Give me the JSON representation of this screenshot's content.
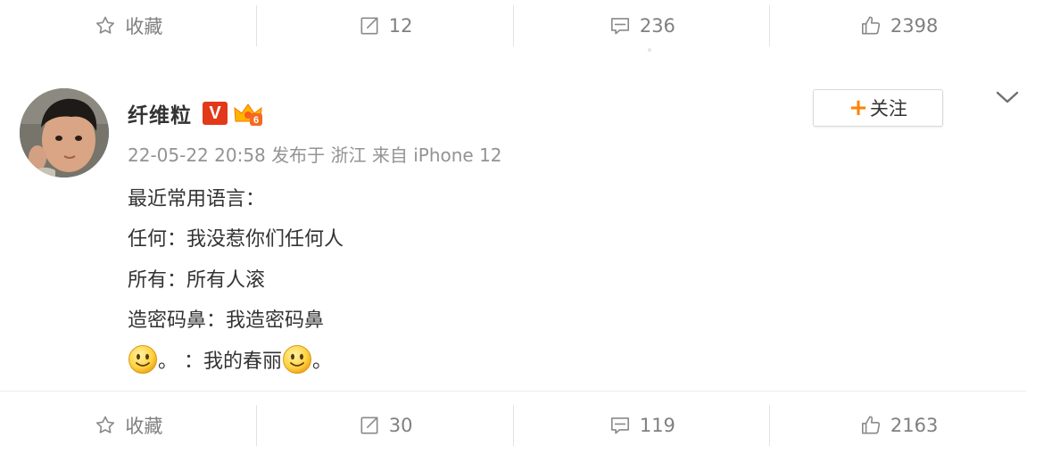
{
  "top_actions": {
    "favorite_label": "收藏",
    "repost_count": "12",
    "comment_count": "236",
    "like_count": "2398"
  },
  "post": {
    "author_name": "纤维粒",
    "vip_badge": "V",
    "level_badge_icon": "level-crown-badge",
    "meta": "22-05-22 20:58 发布于 浙江 来自 iPhone 12",
    "follow_plus": "+",
    "follow_label": "关注",
    "content_lines": [
      "最近常用语言：",
      "任何：我没惹你们任何人",
      "所有：所有人滚",
      "造密码鼻：我造密码鼻"
    ],
    "emoji_line": {
      "part1": "。 ：我的春丽",
      "part2": "。"
    }
  },
  "bottom_actions": {
    "favorite_label": "收藏",
    "repost_count": "30",
    "comment_count": "119",
    "like_count": "2163"
  },
  "colors": {
    "accent_orange": "#ff8200",
    "vip_red": "#e2391a",
    "text_gray": "#808080",
    "meta_gray": "#939393"
  }
}
